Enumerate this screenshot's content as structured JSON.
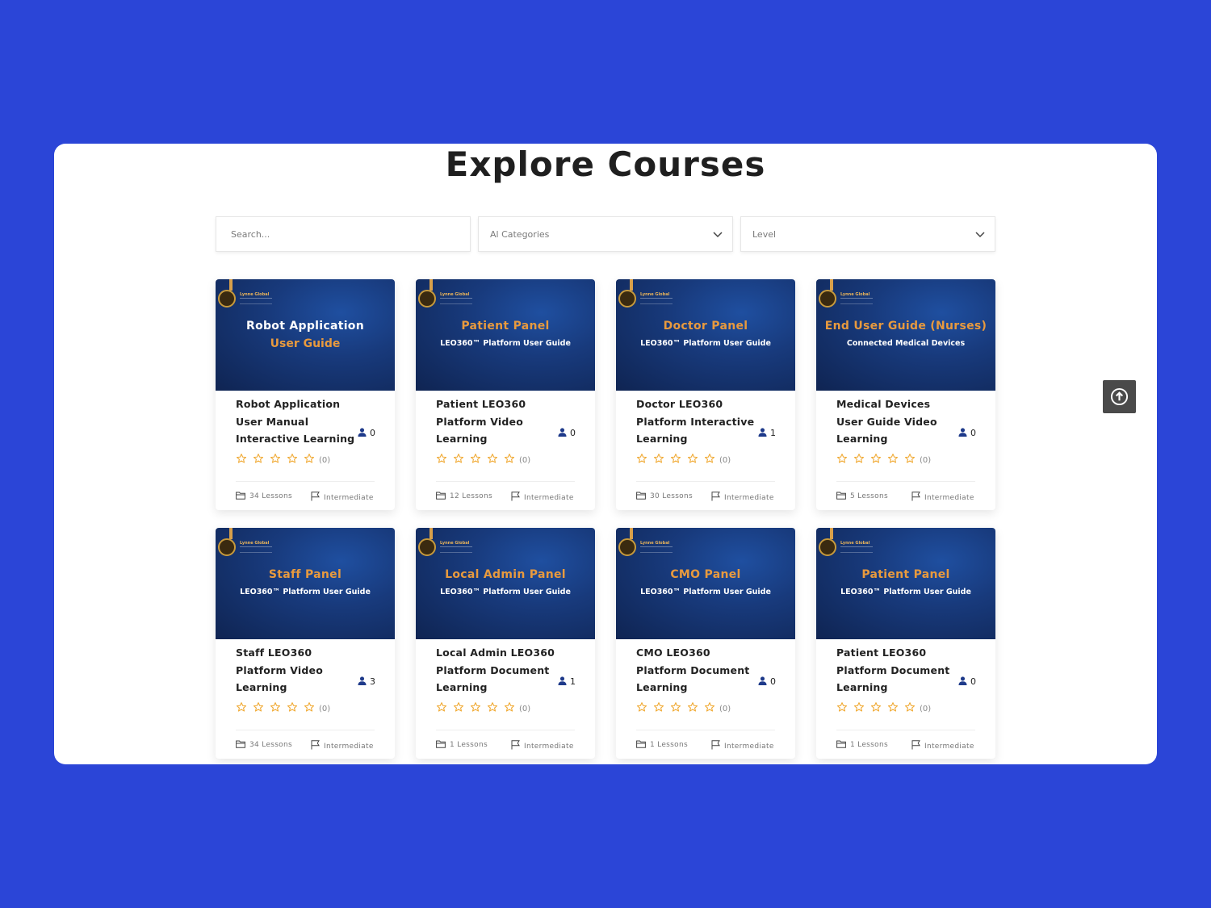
{
  "page": {
    "title": "Explore Courses"
  },
  "filters": {
    "search_placeholder": "Search...",
    "category_selected": "Al Categories",
    "level_selected": "Level"
  },
  "courses": [
    {
      "thumb_title": "Robot Application",
      "thumb_subtitle": "User Guide",
      "thumb_brand": "Lynne Global",
      "title": "Robot Application User Manual Interactive Learning",
      "students": "0",
      "rating_count": "(0)",
      "lessons": "34 Lessons",
      "level": "Intermediate"
    },
    {
      "thumb_title": "Patient Panel",
      "thumb_subtitle": "LEO360™ Platform User Guide",
      "thumb_brand": "Lynne Global",
      "title": "Patient LEO360 Platform Video Learning",
      "students": "0",
      "rating_count": "(0)",
      "lessons": "12 Lessons",
      "level": "Intermediate"
    },
    {
      "thumb_title": "Doctor Panel",
      "thumb_subtitle": "LEO360™ Platform User Guide",
      "thumb_brand": "Lynne Global",
      "title": "Doctor LEO360 Platform Interactive Learning",
      "students": "1",
      "rating_count": "(0)",
      "lessons": "30 Lessons",
      "level": "Intermediate"
    },
    {
      "thumb_title": "End User Guide (Nurses)",
      "thumb_subtitle": "Connected Medical Devices",
      "thumb_brand": "Lynne Global",
      "title": "Medical Devices User Guide Video Learning",
      "students": "0",
      "rating_count": "(0)",
      "lessons": "5 Lessons",
      "level": "Intermediate"
    },
    {
      "thumb_title": "Staff Panel",
      "thumb_subtitle": "LEO360™ Platform User Guide",
      "thumb_brand": "Lynne Global",
      "title": "Staff LEO360 Platform Video Learning",
      "students": "3",
      "rating_count": "(0)",
      "lessons": "34 Lessons",
      "level": "Intermediate"
    },
    {
      "thumb_title": "Local Admin Panel",
      "thumb_subtitle": "LEO360™ Platform User Guide",
      "thumb_brand": "Lynne Global",
      "title": "Local Admin LEO360 Platform Document Learning",
      "students": "1",
      "rating_count": "(0)",
      "lessons": "1 Lessons",
      "level": "Intermediate"
    },
    {
      "thumb_title": "CMO Panel",
      "thumb_subtitle": "LEO360™ Platform User Guide",
      "thumb_brand": "Lynne Global",
      "title": "CMO LEO360 Platform Document Learning",
      "students": "0",
      "rating_count": "(0)",
      "lessons": "1 Lessons",
      "level": "Intermediate"
    },
    {
      "thumb_title": "Patient Panel",
      "thumb_subtitle": "LEO360™ Platform User Guide",
      "thumb_brand": "Lynne Global",
      "title": "Patient LEO360 Platform Document Learning",
      "students": "0",
      "rating_count": "(0)",
      "lessons": "1 Lessons",
      "level": "Intermediate"
    }
  ],
  "colors": {
    "background": "#2b45d7",
    "accent": "#e89a3e",
    "star": "#f0a830",
    "user_icon": "#1e3a8a"
  },
  "icons": {
    "scroll_top": "arrow-up-circle-icon",
    "students": "user-icon",
    "lessons": "folder-icon",
    "level": "flag-icon",
    "dropdown": "chevron-down-icon",
    "rating": "star-outline-icon"
  }
}
